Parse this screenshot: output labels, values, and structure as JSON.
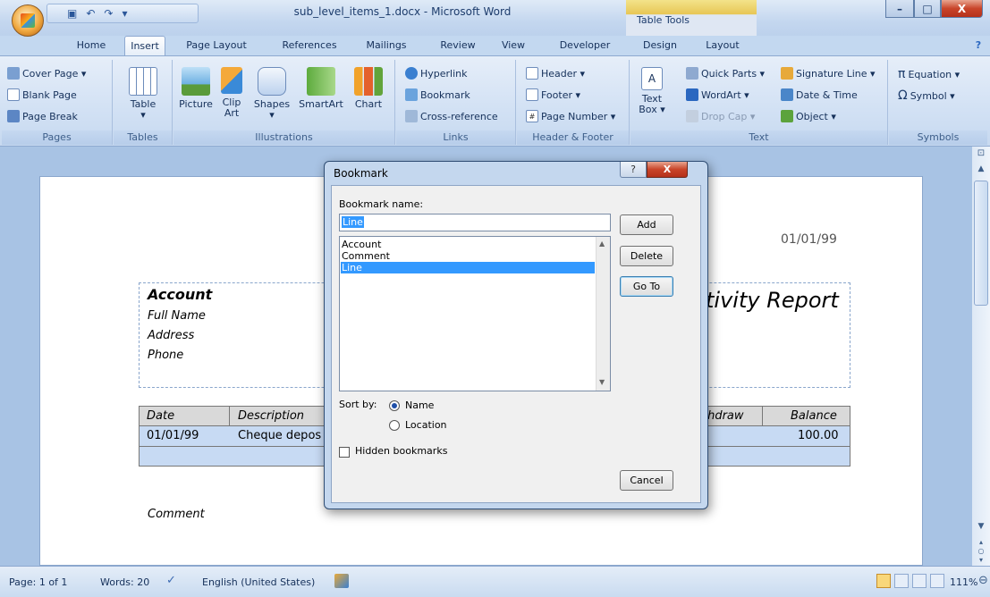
{
  "window": {
    "title": "sub_level_items_1.docx - Microsoft Word",
    "context_tab_group": "Table Tools",
    "controls": {
      "minimize": "–",
      "maximize": "□",
      "close": "X"
    }
  },
  "tabs": [
    "Home",
    "Insert",
    "Page Layout",
    "References",
    "Mailings",
    "Review",
    "View",
    "Developer",
    "Design",
    "Layout"
  ],
  "active_tab": "Insert",
  "ribbon": {
    "pages": {
      "label": "Pages",
      "cover_page": "Cover Page ▾",
      "blank_page": "Blank Page",
      "page_break": "Page Break"
    },
    "tables": {
      "label": "Tables",
      "table": "Table"
    },
    "illustrations": {
      "label": "Illustrations",
      "picture": "Picture",
      "clip_art": "Clip Art",
      "shapes": "Shapes",
      "smartart": "SmartArt",
      "chart": "Chart"
    },
    "links": {
      "label": "Links",
      "hyperlink": "Hyperlink",
      "bookmark": "Bookmark",
      "cross_reference": "Cross-reference"
    },
    "header_footer": {
      "label": "Header & Footer",
      "header": "Header ▾",
      "footer": "Footer ▾",
      "page_number": "Page Number ▾"
    },
    "text": {
      "label": "Text",
      "text_box": "Text Box ▾",
      "quick_parts": "Quick Parts ▾",
      "wordart": "WordArt ▾",
      "drop_cap": "Drop Cap ▾",
      "signature_line": "Signature Line ▾",
      "date_time": "Date & Time",
      "object": "Object ▾"
    },
    "symbols": {
      "label": "Symbols",
      "equation": "Equation ▾",
      "symbol": "Symbol ▾"
    }
  },
  "document": {
    "date": "01/01/99",
    "account_heading": "Account",
    "fields": [
      "Full Name",
      "Address",
      "Phone"
    ],
    "report_title": "tivity Report",
    "table_headers": {
      "date": "Date",
      "description": "Description",
      "withdraw": "thdraw",
      "balance": "Balance"
    },
    "row": {
      "date": "01/01/99",
      "description": "Cheque depos",
      "balance": "100.00"
    },
    "comment": "Comment"
  },
  "dialog": {
    "title": "Bookmark",
    "help": "?",
    "close": "X",
    "name_label": "Bookmark name:",
    "name_value": "Line",
    "items": [
      "Account",
      "Comment",
      "Line"
    ],
    "selected": "Line",
    "sort_label": "Sort by:",
    "sort_options": [
      "Name",
      "Location"
    ],
    "sort_selected": "Name",
    "hidden_label": "Hidden bookmarks",
    "buttons": {
      "add": "Add",
      "delete": "Delete",
      "goto": "Go To",
      "cancel": "Cancel"
    }
  },
  "status": {
    "page": "Page: 1 of 1",
    "words": "Words: 20",
    "language": "English (United States)",
    "zoom": "111%"
  }
}
